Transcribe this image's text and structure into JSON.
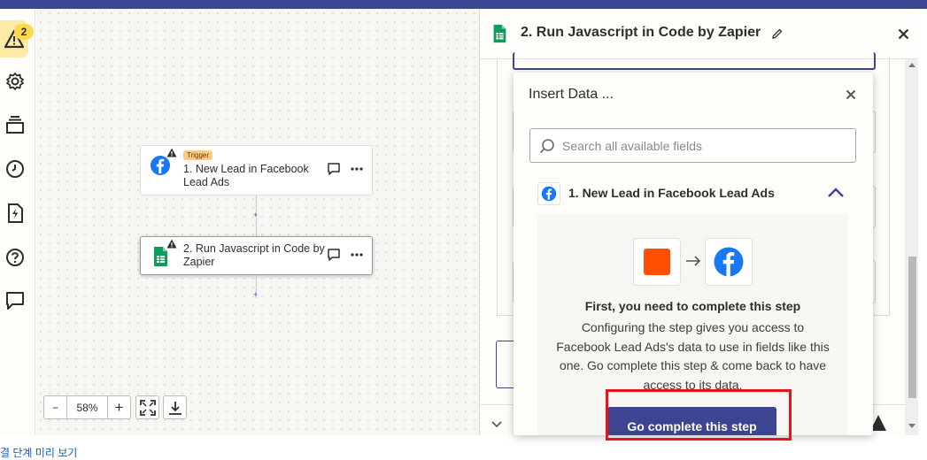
{
  "rail": {
    "alert_count": "2",
    "items": [
      "warning-icon",
      "settings-icon",
      "layers-icon",
      "history-icon",
      "zap-file-icon",
      "help-icon",
      "comment-icon"
    ]
  },
  "canvas": {
    "nodes": [
      {
        "tag": "Trigger",
        "title": "1. New Lead in Facebook Lead Ads"
      },
      {
        "title": "2. Run Javascript in Code by Zapier"
      }
    ],
    "connector_plus": "+",
    "zoom_value": "58%",
    "zoom_minus": "−",
    "zoom_plus": "+"
  },
  "panel": {
    "title": "2. Run Javascript in Code by Zapier"
  },
  "insert_data": {
    "title": "Insert Data ...",
    "search_placeholder": "Search all available fields",
    "section_title": "1. New Lead in Facebook Lead Ads",
    "heading": "First, you need to complete this step",
    "body": "Configuring the step gives you access to Facebook Lead Ads's data to use in fields like this one. Go complete this step & come back to have access to its data.",
    "button_label": "Go complete this step"
  },
  "bottom_link": "결 단계 미리 보기",
  "colors": {
    "brand_navy": "#3d4592",
    "zapier_orange": "#ff4f00",
    "facebook_blue": "#1877f2",
    "sheets_green": "#0f9d58",
    "highlight_red": "#e8141b"
  }
}
